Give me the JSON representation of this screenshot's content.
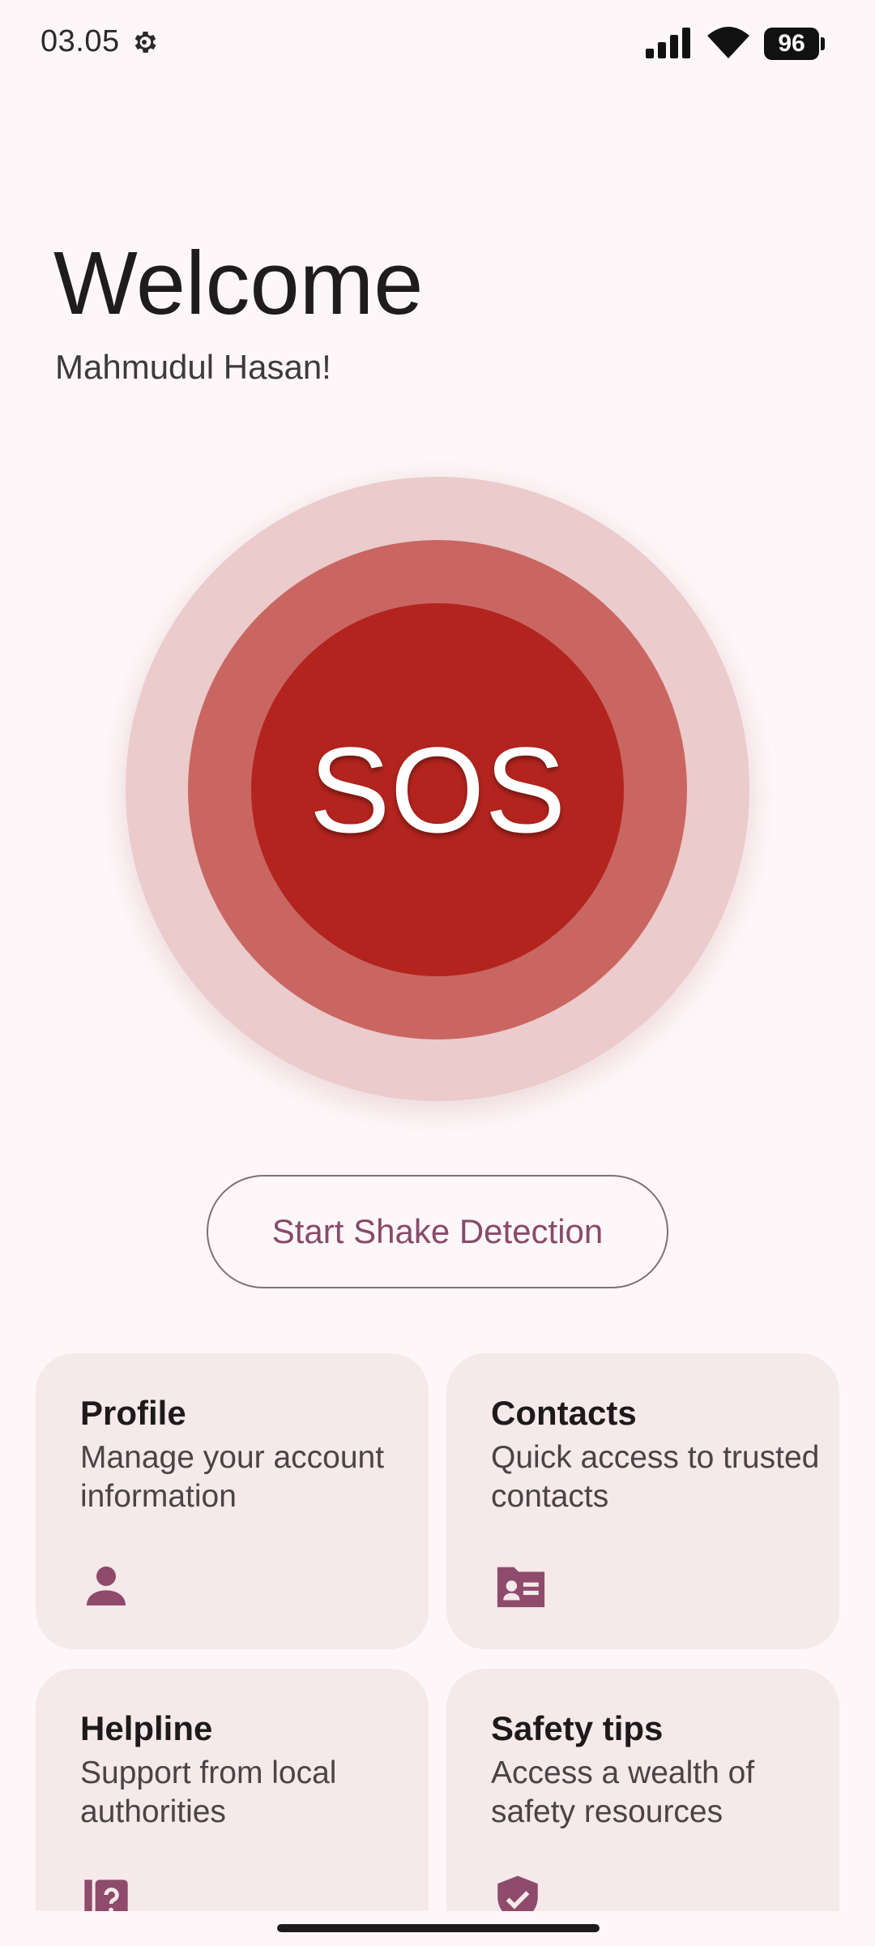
{
  "status_bar": {
    "time": "03.05",
    "battery": "96",
    "icons": [
      "gear-icon",
      "signal-icon",
      "wifi-icon",
      "battery-icon"
    ]
  },
  "welcome": {
    "title": "Welcome",
    "name": "Mahmudul Hasan!"
  },
  "sos": {
    "label": "SOS",
    "colors": {
      "outer": "#EBCBCB",
      "middle": "#C96662",
      "inner": "#B3241E"
    }
  },
  "shake_button": {
    "label": "Start Shake Detection"
  },
  "cards": [
    {
      "title": "Profile",
      "description": "Manage your account information",
      "icon": "person-icon"
    },
    {
      "title": "Contacts",
      "description": "Quick access to trusted contacts",
      "icon": "contact-card-icon"
    },
    {
      "title": "Helpline",
      "description": "Support from local authorities",
      "icon": "help-book-icon"
    },
    {
      "title": "Safety tips",
      "description": "Access a wealth of safety resources",
      "icon": "shield-check-icon"
    }
  ],
  "colors": {
    "background": "#FEF7F9",
    "card_bg": "#F5E9EA",
    "accent": "#8A4A6A",
    "icon": "#8E4B6B"
  }
}
